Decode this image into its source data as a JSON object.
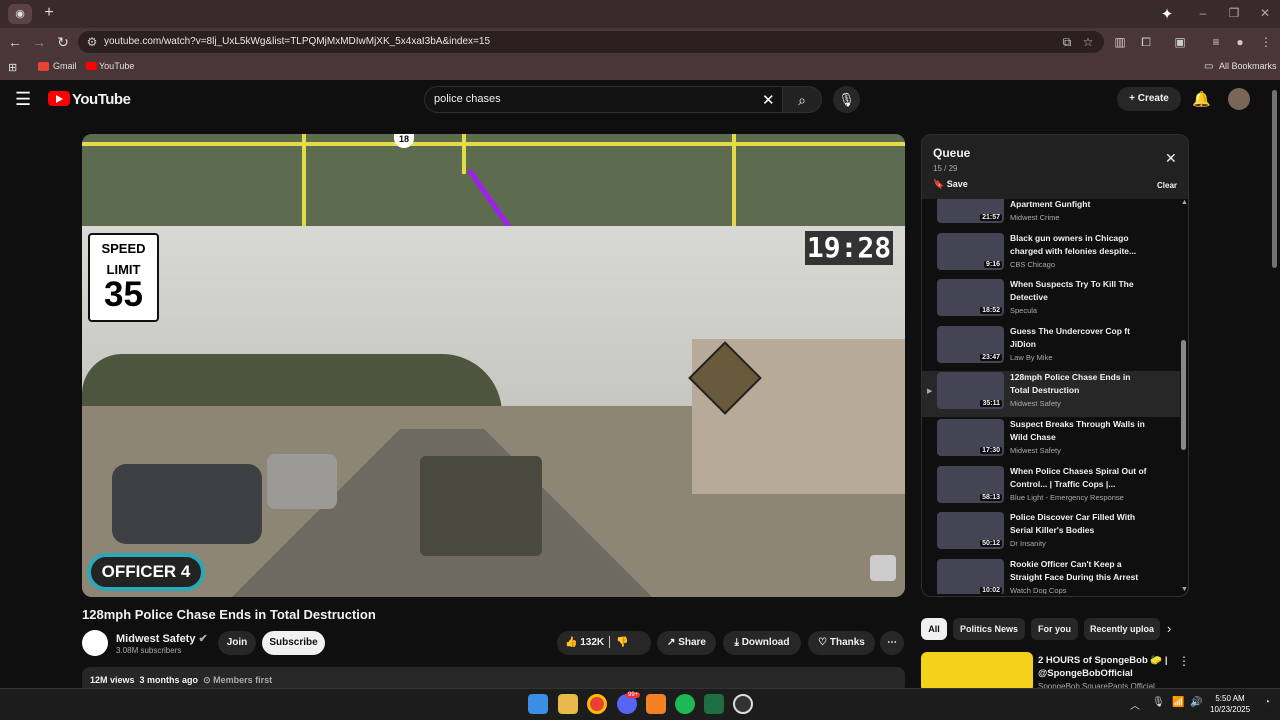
{
  "browser": {
    "tabs": {
      "new_tab_label": "+",
      "tab_icon": "tab-favicon"
    },
    "url": "youtube.com/watch?v=8lj_UxL5kWg&list=TLPQMjMxMDIwMjXK_5x4xaI3bA&index=15",
    "bookmarks": [
      {
        "label": "Gmail",
        "icon": "gmail-icon"
      },
      {
        "label": "YouTube",
        "icon": "youtube-icon"
      }
    ],
    "all_bookmarks": "All Bookmarks",
    "window_controls": {
      "minimize": "–",
      "restore": "❐",
      "close": "✕"
    }
  },
  "header": {
    "brand": "YouTube",
    "search_value": "police chases",
    "create_label": "Create"
  },
  "video": {
    "speed_limit_top": "SPEED",
    "speed_limit_mid": "LIMIT",
    "speed_limit_value": "35",
    "clock_overlay": "19:28",
    "officer_label": "OFFICER 4",
    "title": "128mph Police Chase Ends in Total Destruction",
    "channel": "Midwest Safety",
    "subscribers": "3.08M subscribers",
    "join_label": "Join",
    "subscribe_label": "Subscribe",
    "likes": "132K",
    "share_label": "Share",
    "download_label": "Download",
    "thanks_label": "Thanks",
    "views": "12M views",
    "ago": "3 months ago",
    "members": "Members first"
  },
  "queue": {
    "title": "Queue",
    "count": "15 / 29",
    "save_label": "Save",
    "clear_label": "Clear",
    "items": [
      {
        "title": "Warrant Attempt Turns Into Apartment Gunfight",
        "channel": "Midwest Crime",
        "duration": "21:57",
        "active": false
      },
      {
        "title": "Black gun owners in Chicago charged with felonies despite...",
        "channel": "CBS Chicago",
        "duration": "9:16",
        "active": false
      },
      {
        "title": "When Suspects Try To Kill The Detective",
        "channel": "Specula",
        "duration": "18:52",
        "active": false
      },
      {
        "title": "Guess The Undercover Cop ft JiDion",
        "channel": "Law By Mike",
        "duration": "23:47",
        "active": false
      },
      {
        "title": "128mph Police Chase Ends in Total Destruction",
        "channel": "Midwest Safety",
        "duration": "35:11",
        "active": true
      },
      {
        "title": "Suspect Breaks Through Walls in Wild Chase",
        "channel": "Midwest Safety",
        "duration": "17:30",
        "active": false
      },
      {
        "title": "When Police Chases Spiral Out of Control... | Traffic Cops |...",
        "channel": "Blue Light - Emergency Response",
        "duration": "58:13",
        "active": false
      },
      {
        "title": "Police Discover Car Filled With Serial Killer's Bodies",
        "channel": "Dr Insanity",
        "duration": "50:12",
        "active": false
      },
      {
        "title": "Rookie Officer Can't Keep a Straight Face During this Arrest",
        "channel": "Watch Dog Cops",
        "duration": "10:02",
        "active": false
      }
    ]
  },
  "chips": [
    "All",
    "Politics News",
    "For you",
    "Recently uploa"
  ],
  "recommendation": {
    "title": "2 HOURS of SpongeBob 🧽 | @SpongeBobOfficial",
    "channel": "SpongeBob SquarePants Official"
  },
  "taskbar": {
    "time": "5:50 AM",
    "date": "10/23/2025",
    "notification_badge": "99+"
  }
}
